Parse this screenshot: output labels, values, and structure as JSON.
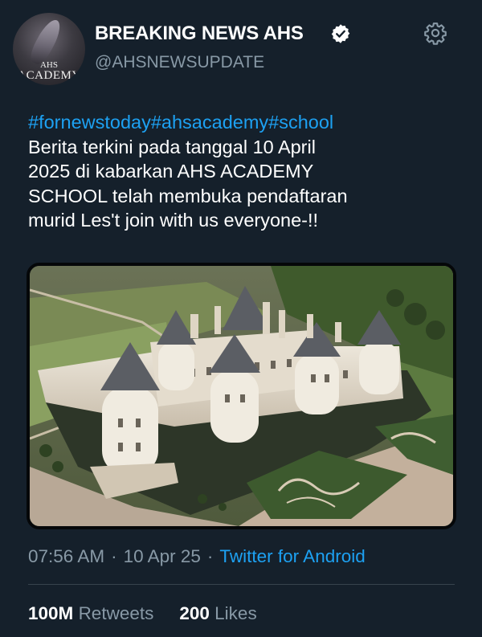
{
  "user": {
    "display_name": "BREAKING NEWS AHS",
    "handle": "@AHSNEWSUPDATE",
    "avatar_text": {
      "line1": "AHS",
      "line2": "ACADEMY"
    },
    "verified_icon": "verified-badge-icon"
  },
  "settings_icon": "gear-icon",
  "tweet": {
    "hashtags": "#fornewstoday#ahsacademy#school",
    "lines": [
      "Berita terkini pada tanggal 10 April",
      "2025 di kabarkan AHS ACADEMY",
      "SCHOOL telah membuka pendaftaran",
      "murid Les't join with us everyone-!!"
    ]
  },
  "media": {
    "icon": "aerial-castle-photo"
  },
  "meta": {
    "time": "07:56 AM",
    "separator": "·",
    "date": "10 Apr 25",
    "source": "Twitter for Android"
  },
  "stats": {
    "retweets": {
      "value": "100M",
      "label": "Retweets"
    },
    "likes": {
      "value": "200",
      "label": "Likes"
    }
  },
  "colors": {
    "background": "#15202b",
    "link": "#1da1f2",
    "muted": "#8899a6",
    "divider": "#38444d"
  }
}
